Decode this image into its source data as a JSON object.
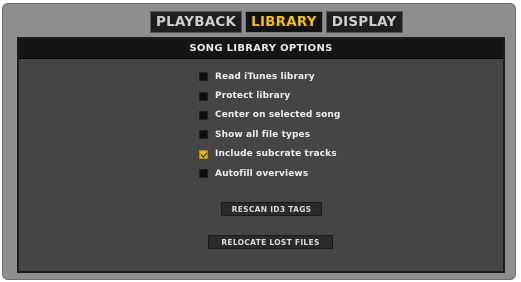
{
  "tabs": [
    {
      "label": "PLAYBACK",
      "active": false
    },
    {
      "label": "LIBRARY",
      "active": true
    },
    {
      "label": "DISPLAY",
      "active": false
    }
  ],
  "panel": {
    "title": "SONG LIBRARY OPTIONS"
  },
  "options": [
    {
      "label": "Read iTunes library",
      "checked": false
    },
    {
      "label": "Protect library",
      "checked": false
    },
    {
      "label": "Center on selected song",
      "checked": false
    },
    {
      "label": "Show all file types",
      "checked": false
    },
    {
      "label": "Include subcrate tracks",
      "checked": true
    },
    {
      "label": "Autofill overviews",
      "checked": false
    }
  ],
  "buttons": {
    "rescan": "RESCAN ID3 TAGS",
    "relocate": "RELOCATE LOST FILES"
  },
  "colors": {
    "accent": "#f2c200",
    "panel_bg": "#454545",
    "frame_bg": "#8e8e8e"
  }
}
